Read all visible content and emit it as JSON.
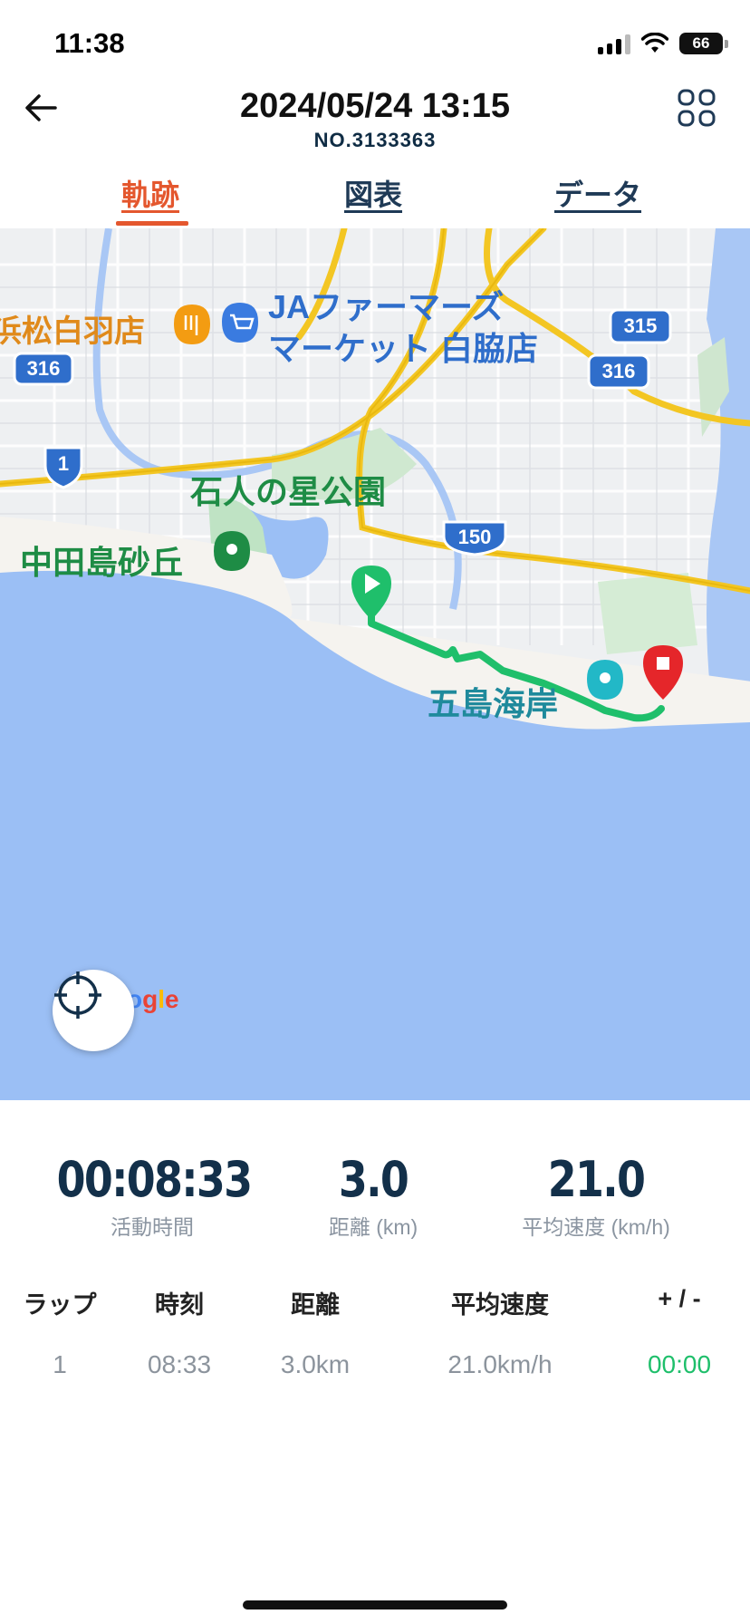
{
  "status_bar": {
    "time": "11:38",
    "battery": "66"
  },
  "header": {
    "title": "2024/05/24 13:15",
    "subtitle": "NO.3133363"
  },
  "tabs": [
    {
      "label": "軌跡"
    },
    {
      "label": "図表"
    },
    {
      "label": "データ"
    }
  ],
  "map": {
    "labels": {
      "ja_market_line1": "JAファーマーズ",
      "ja_market_line2": "マーケット 白脇店",
      "hamamatsu_shirowa": "浜松白羽店",
      "ishibito_park": "石人の星公園",
      "nakatajima_dunes": "中田島砂丘",
      "goshima_coast": "五島海岸",
      "route_316_left": "316",
      "route_316_right": "316",
      "route_315": "315",
      "route_1": "1",
      "route_150": "150"
    },
    "google_logo": "ogle",
    "colors": {
      "sea": "#9bbff5",
      "route": "#1fbf6b",
      "park": "#1e8c45",
      "poi": "#f39c12",
      "end_pin": "#e5262a"
    }
  },
  "stats": [
    {
      "value": "00:08:33",
      "label": "活動時間"
    },
    {
      "value": "3.0",
      "label": "距離 (km)"
    },
    {
      "value": "21.0",
      "label": "平均速度 (km/h)"
    }
  ],
  "lap_table": {
    "headers": [
      "ラップ",
      "時刻",
      "距離",
      "平均速度",
      "+ / -"
    ],
    "rows": [
      [
        "1",
        "08:33",
        "3.0km",
        "21.0km/h",
        "00:00"
      ]
    ]
  }
}
